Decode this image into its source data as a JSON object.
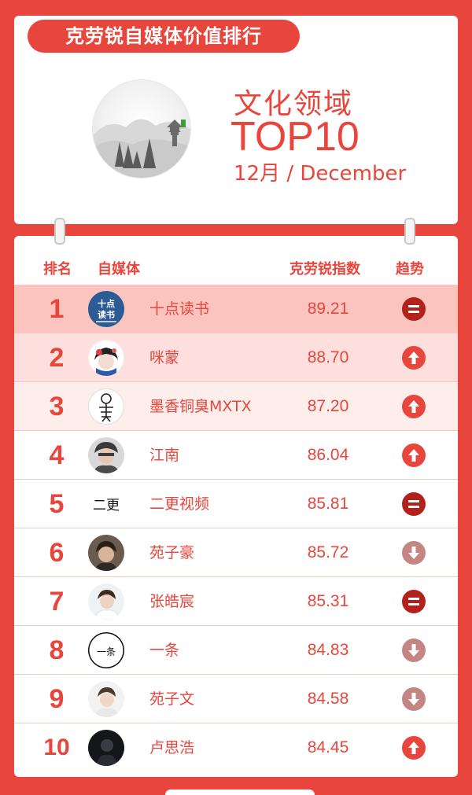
{
  "header": {
    "ribbon_title": "克劳锐自媒体价值排行",
    "category": "文化领域",
    "top_label": "TOP10",
    "month": "12月 / December"
  },
  "columns": {
    "rank": "排名",
    "media": "自媒体",
    "index": "克劳锐指数",
    "trend": "趋势"
  },
  "rows": [
    {
      "rank": "1",
      "name": "十点读书",
      "score": "89.21",
      "trend": "equal"
    },
    {
      "rank": "2",
      "name": "咪蒙",
      "score": "88.70",
      "trend": "up"
    },
    {
      "rank": "3",
      "name": "墨香铜臭MXTX",
      "score": "87.20",
      "trend": "up"
    },
    {
      "rank": "4",
      "name": "江南",
      "score": "86.04",
      "trend": "up"
    },
    {
      "rank": "5",
      "name": "二更视频",
      "score": "85.81",
      "trend": "equal"
    },
    {
      "rank": "6",
      "name": "苑子豪",
      "score": "85.72",
      "trend": "down"
    },
    {
      "rank": "7",
      "name": "张皓宸",
      "score": "85.31",
      "trend": "equal"
    },
    {
      "rank": "8",
      "name": "一条",
      "score": "84.83",
      "trend": "down"
    },
    {
      "rank": "9",
      "name": "苑子文",
      "score": "84.58",
      "trend": "down"
    },
    {
      "rank": "10",
      "name": "卢思浩",
      "score": "84.45",
      "trend": "up"
    }
  ],
  "logos": {
    "shidian_top": "十点",
    "shidian_bottom": "读书",
    "ergeng": "二更",
    "yitiao": "一条"
  },
  "colors": {
    "brand_red": "#e8463c",
    "trend_up": "#e8463c",
    "trend_equal": "#b3211b",
    "trend_down": "#c48683"
  }
}
